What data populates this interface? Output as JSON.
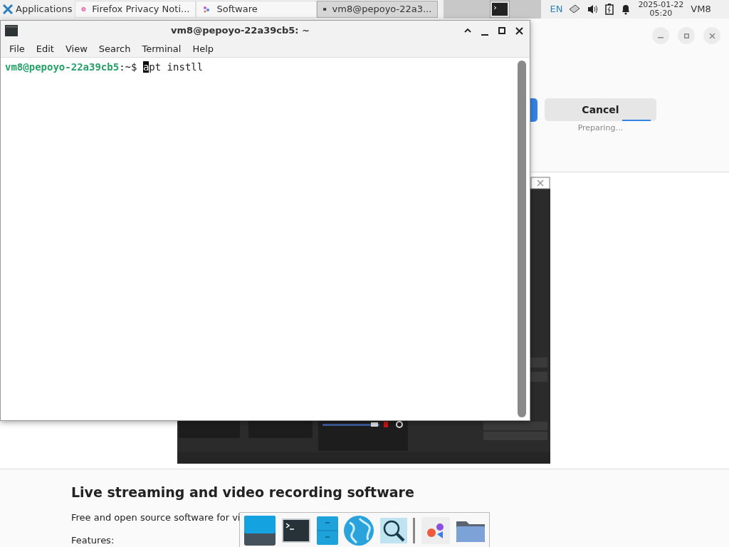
{
  "panel": {
    "app_menu": "Applications",
    "tasks": [
      {
        "label": "Firefox Privacy Noti...",
        "kind": "browser",
        "selected": false
      },
      {
        "label": "Software",
        "kind": "software",
        "selected": false
      },
      {
        "label": "vm8@pepoyo-22a3...",
        "kind": "terminal",
        "selected": true
      }
    ],
    "language": "EN",
    "date": "2025-01-22",
    "time": "05:20",
    "user": "VM8"
  },
  "terminal": {
    "title": "vm8@pepoyo-22a39cb5: ~",
    "menu": [
      "File",
      "Edit",
      "View",
      "Search",
      "Terminal",
      "Help"
    ],
    "prompt_user": "vm8@pepoyo-22a39cb5",
    "prompt_path": ":~$",
    "cursor_char": "a",
    "command_rest": "pt instll"
  },
  "software": {
    "cancel": "Cancel",
    "status": "Preparing…",
    "heading": "Live streaming and video recording software",
    "description": "Free and open source software for vi",
    "features_label": "Features:"
  },
  "dock": [
    {
      "kind": "desktop"
    },
    {
      "kind": "terminal"
    },
    {
      "kind": "files"
    },
    {
      "kind": "globe"
    },
    {
      "kind": "search"
    },
    {
      "kind": "separator"
    },
    {
      "kind": "apps"
    },
    {
      "kind": "folder"
    }
  ]
}
